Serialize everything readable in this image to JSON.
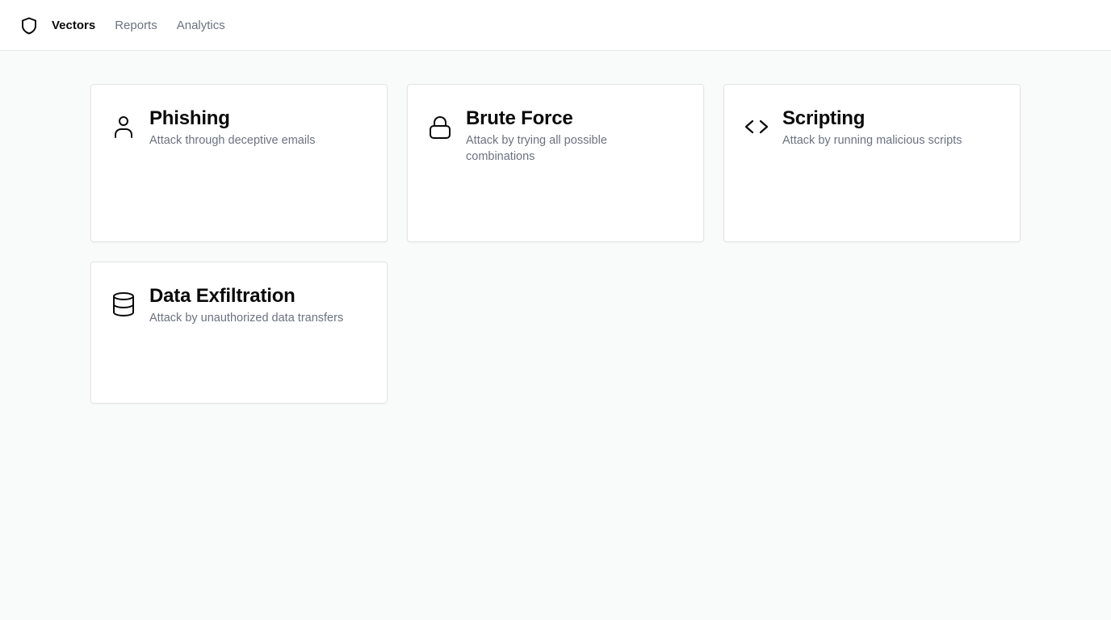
{
  "nav": {
    "logo_icon": "shield-icon",
    "items": [
      {
        "label": "Vectors",
        "active": true
      },
      {
        "label": "Reports",
        "active": false
      },
      {
        "label": "Analytics",
        "active": false
      }
    ]
  },
  "cards": [
    {
      "title": "Phishing",
      "description": "Attack through deceptive emails",
      "icon": "user-icon"
    },
    {
      "title": "Brute Force",
      "description": "Attack by trying all possible combinations",
      "icon": "lock-icon"
    },
    {
      "title": "Scripting",
      "description": "Attack by running malicious scripts",
      "icon": "code-icon"
    },
    {
      "title": "Data Exfiltration",
      "description": "Attack by unauthorized data transfers",
      "icon": "database-icon"
    }
  ]
}
